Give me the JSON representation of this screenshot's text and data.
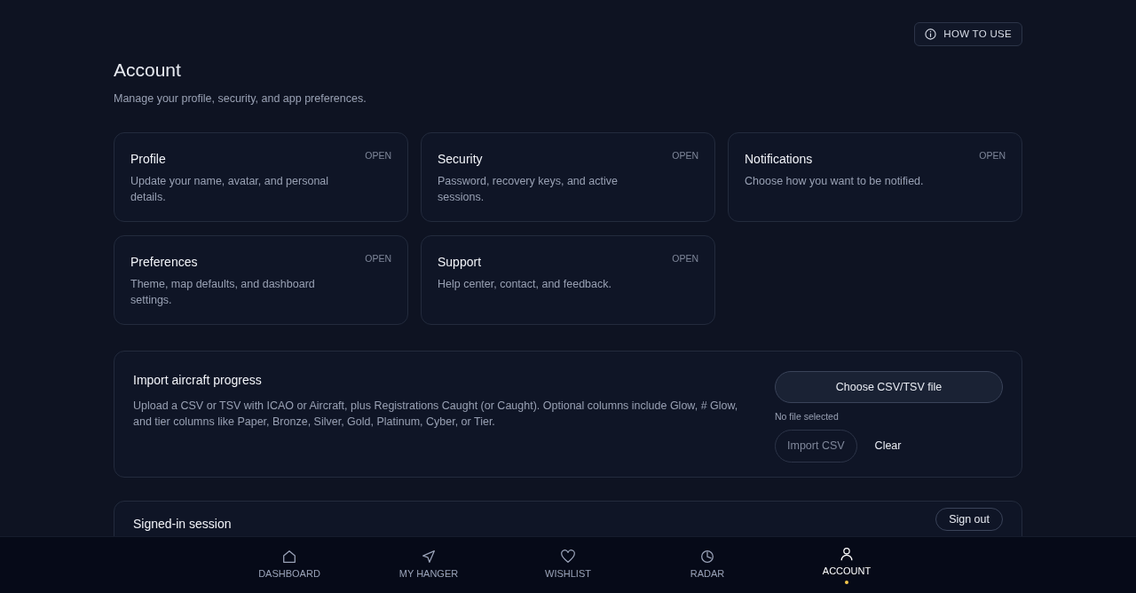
{
  "help_button": {
    "label": "HOW TO USE"
  },
  "page": {
    "title": "Account",
    "subtitle": "Manage your profile, security, and app preferences."
  },
  "cards": [
    {
      "title": "Profile",
      "description": "Update your name, avatar, and personal details.",
      "action": "OPEN"
    },
    {
      "title": "Security",
      "description": "Password, recovery keys, and active sessions.",
      "action": "OPEN"
    },
    {
      "title": "Notifications",
      "description": "Choose how you want to be notified.",
      "action": "OPEN"
    },
    {
      "title": "Preferences",
      "description": "Theme, map defaults, and dashboard settings.",
      "action": "OPEN"
    },
    {
      "title": "Support",
      "description": "Help center, contact, and feedback.",
      "action": "OPEN"
    }
  ],
  "import": {
    "title": "Import aircraft progress",
    "description": "Upload a CSV or TSV with ICAO or Aircraft, plus Registrations Caught (or Caught). Optional columns include Glow, # Glow, and tier columns like Paper, Bronze, Silver, Gold, Platinum, Cyber, or Tier.",
    "choose_button": "Choose CSV/TSV file",
    "file_status": "No file selected",
    "import_button": {
      "label": "Import CSV",
      "disabled": true
    },
    "clear_button": "Clear"
  },
  "session": {
    "title": "Signed-in session",
    "sign_out_button": "Sign out"
  },
  "nav": [
    {
      "label": "DASHBOARD",
      "selected": false
    },
    {
      "label": "MY HANGER",
      "selected": false
    },
    {
      "label": "WISHLIST",
      "selected": false
    },
    {
      "label": "RADAR",
      "selected": false
    },
    {
      "label": "ACCOUNT",
      "selected": true
    }
  ]
}
